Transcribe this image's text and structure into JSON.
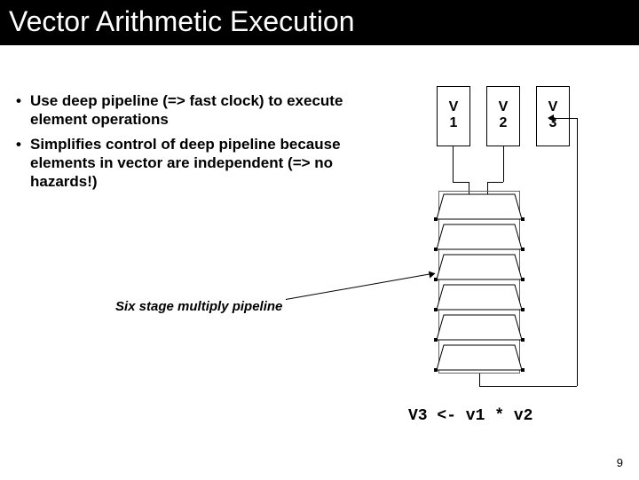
{
  "title": "Vector Arithmetic Execution",
  "bullets": [
    "Use deep pipeline (=> fast clock) to execute element operations",
    "Simplifies control of deep pipeline because elements in vector are independent (=> no hazards!)"
  ],
  "caption": "Six stage multiply pipeline",
  "registers": {
    "v1_top": "V",
    "v1_bot": "1",
    "v2_top": "V",
    "v2_bot": "2",
    "v3_top": "V",
    "v3_bot": "3"
  },
  "result": "V3 <- v1 * v2",
  "page": "9"
}
